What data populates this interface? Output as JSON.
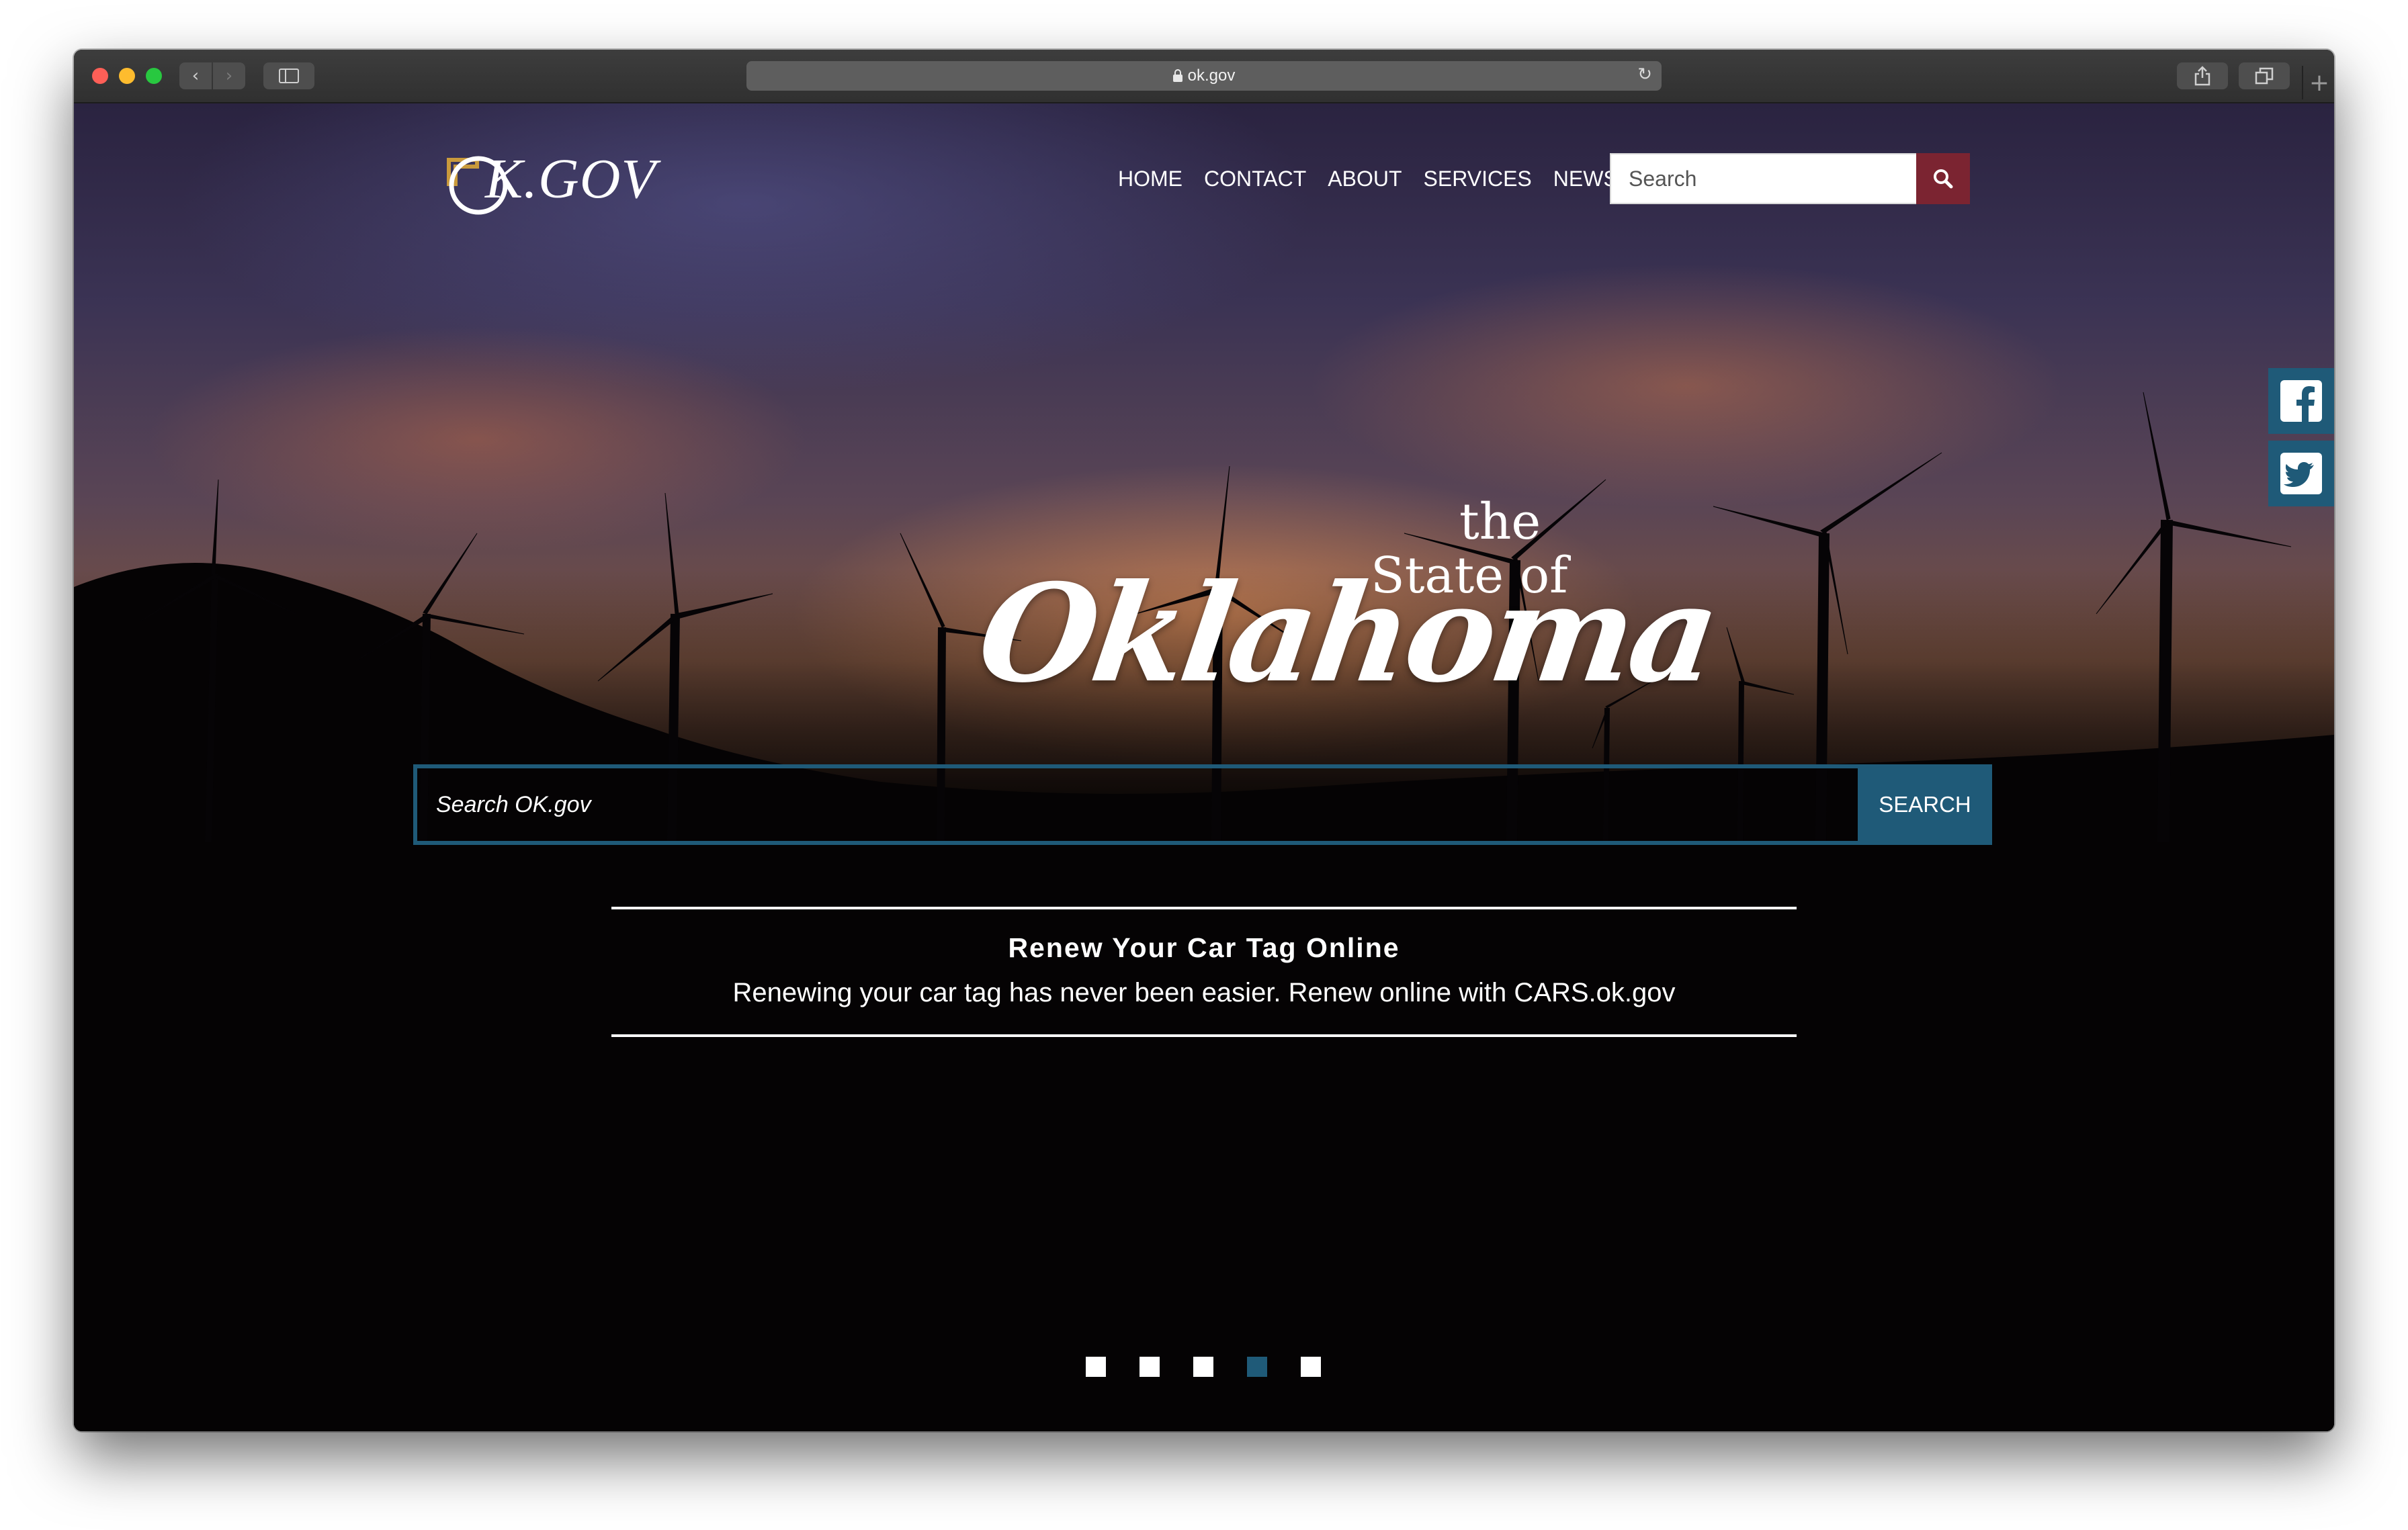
{
  "browser": {
    "url": "ok.gov"
  },
  "header": {
    "logo_text": "K.GOV",
    "nav": [
      {
        "label": "HOME"
      },
      {
        "label": "CONTACT"
      },
      {
        "label": "ABOUT"
      },
      {
        "label": "SERVICES"
      },
      {
        "label": "NEWS"
      }
    ],
    "search_placeholder": "Search",
    "search_icon": "search-icon"
  },
  "social": [
    {
      "name": "facebook",
      "icon": "facebook-icon"
    },
    {
      "name": "twitter",
      "icon": "twitter-icon"
    }
  ],
  "hero": {
    "line1": "the",
    "line2": "State of",
    "line3": "Oklahoma",
    "search_placeholder": "Search OK.gov",
    "search_button": "SEARCH"
  },
  "promo": {
    "title": "Renew Your Car Tag Online",
    "text": "Renewing your car tag has never been easier. Renew online with CARS.ok.gov"
  },
  "carousel": {
    "slide_count": 5,
    "active_slide": 4
  },
  "colors": {
    "accent_blue": "#1f5a78",
    "header_search_button": "#7b2431"
  }
}
